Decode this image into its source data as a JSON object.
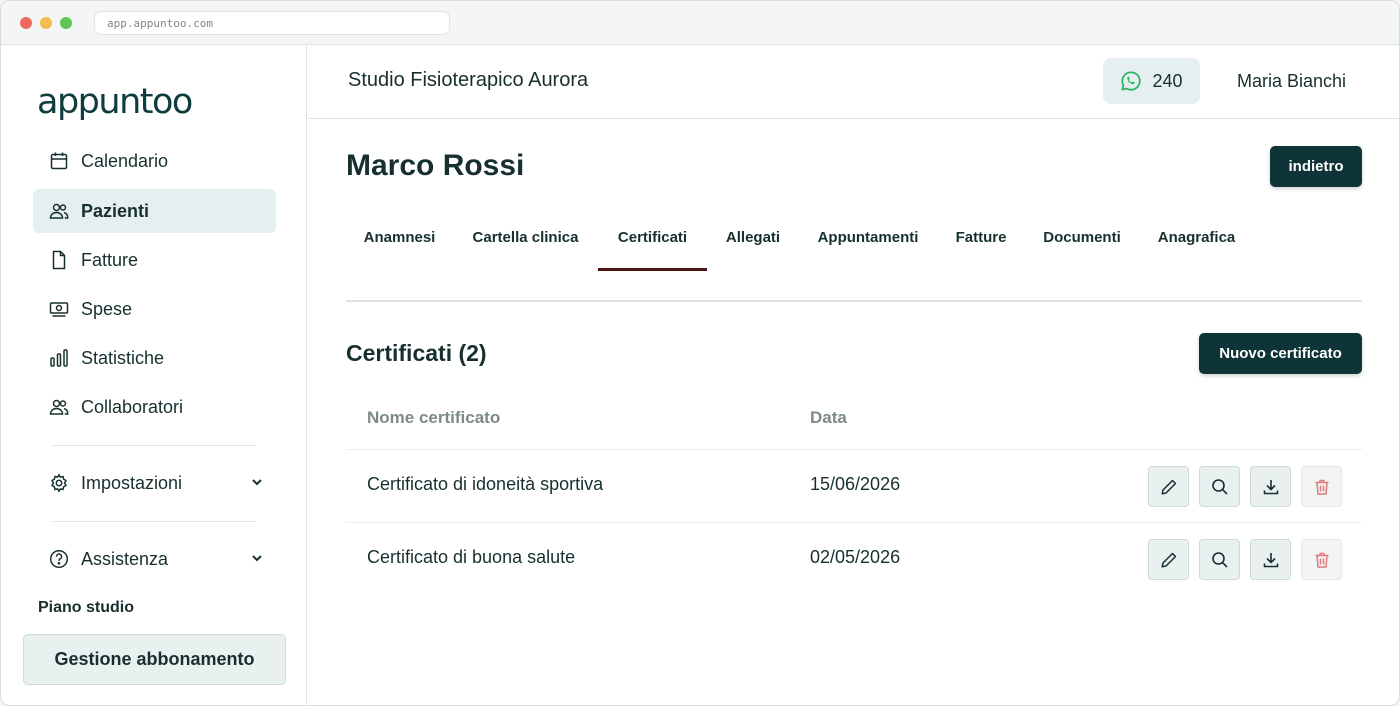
{
  "browser": {
    "url": "app.appuntoo.com"
  },
  "sidebar": {
    "logo": "appuntoo",
    "items": [
      {
        "label": "Calendario",
        "icon": "calendar-icon"
      },
      {
        "label": "Pazienti",
        "icon": "users-icon",
        "active": true
      },
      {
        "label": "Fatture",
        "icon": "document-icon"
      },
      {
        "label": "Spese",
        "icon": "money-icon"
      },
      {
        "label": "Statistiche",
        "icon": "bar-chart-icon"
      },
      {
        "label": "Collaboratori",
        "icon": "users-icon"
      },
      {
        "label": "Impostazioni",
        "icon": "gear-icon"
      },
      {
        "label": "Assistenza",
        "icon": "help-circle-icon"
      }
    ],
    "plan_title": "Piano studio",
    "plan_button": "Gestione abbonamento"
  },
  "topbar": {
    "studio_name": "Studio Fisioterapico Aurora",
    "whatsapp_count": "240",
    "user_name": "Maria Bianchi"
  },
  "patient": {
    "name": "Marco Rossi",
    "back_button": "indietro"
  },
  "tabs": [
    {
      "label": "Anamnesi"
    },
    {
      "label": "Cartella clinica"
    },
    {
      "label": "Certificati",
      "active": true
    },
    {
      "label": "Allegati"
    },
    {
      "label": "Appuntamenti"
    },
    {
      "label": "Fatture"
    },
    {
      "label": "Documenti"
    },
    {
      "label": "Anagrafica"
    }
  ],
  "certificates": {
    "title": "Certificati (2)",
    "new_button": "Nuovo certificato",
    "columns": {
      "name": "Nome certificato",
      "date": "Data"
    },
    "rows": [
      {
        "name": "Certificato di idoneità sportiva",
        "date": "15/06/2026"
      },
      {
        "name": "Certificato di buona salute",
        "date": "02/05/2026"
      }
    ]
  },
  "colors": {
    "primary_dark": "#0f3437",
    "active_tab_underline": "#4a1512",
    "active_nav_bg": "#e6efef",
    "whatsapp_green": "#25b360",
    "delete_red": "#e07b7b"
  }
}
